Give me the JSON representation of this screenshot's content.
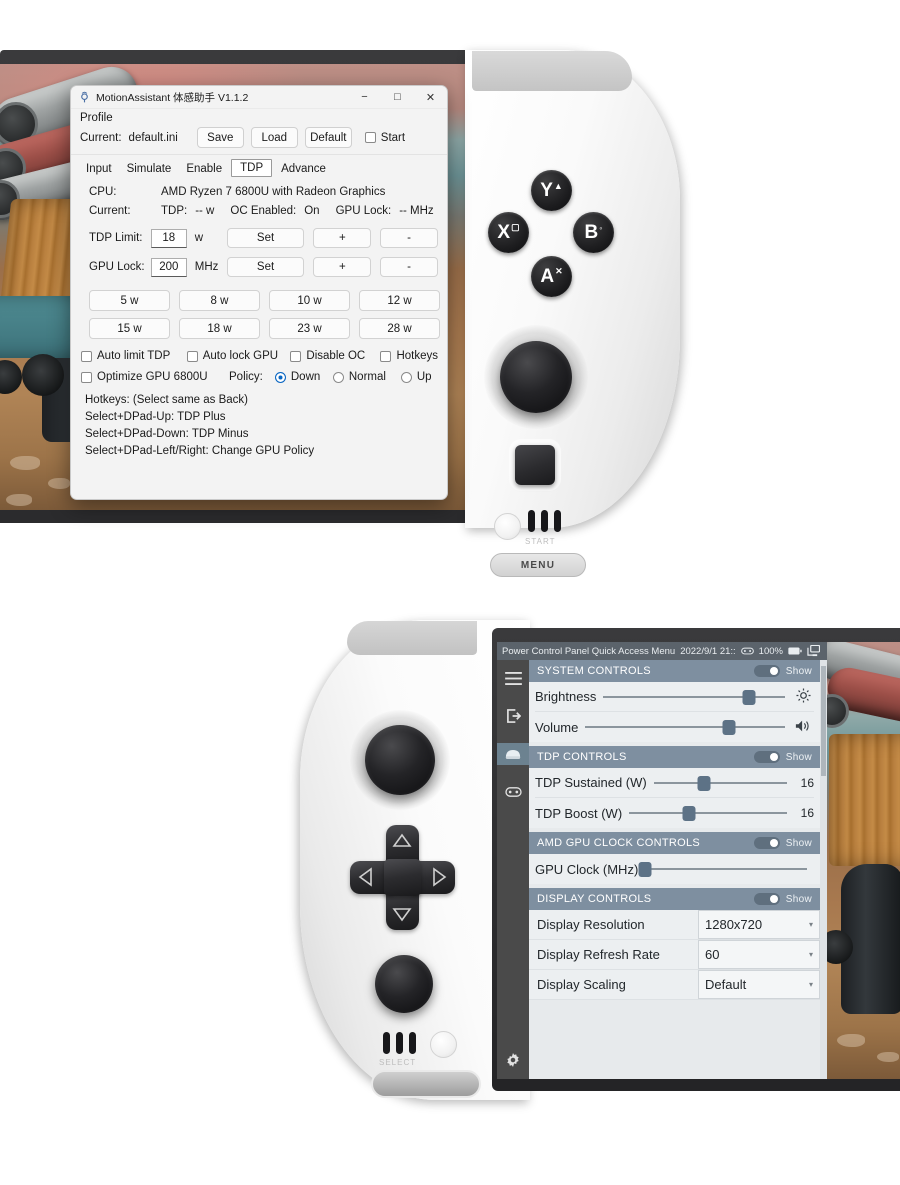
{
  "motion_assistant": {
    "title": "MotionAssistant 体感助手 V1.1.2",
    "icon": "app-icon",
    "window_controls": {
      "minimize": "−",
      "maximize": "□",
      "close": "✕"
    },
    "profile": {
      "heading": "Profile",
      "current_label": "Current:",
      "current_value": "default.ini",
      "save": "Save",
      "load": "Load",
      "default": "Default",
      "start_label": "Start",
      "start_checked": false
    },
    "tabs": [
      {
        "label": "Input",
        "active": false
      },
      {
        "label": "Simulate",
        "active": false
      },
      {
        "label": "Enable",
        "active": false
      },
      {
        "label": "TDP",
        "active": true
      },
      {
        "label": "Advance",
        "active": false
      }
    ],
    "cpu_label": "CPU:",
    "cpu_value": "AMD Ryzen 7 6800U with Radeon Graphics",
    "current_row": {
      "label": "Current:",
      "tdp_label": "TDP:",
      "tdp_value": "-- w",
      "oc_label": "OC Enabled:",
      "oc_value": "On",
      "gpu_lock_label": "GPU Lock:",
      "gpu_lock_value": "-- MHz"
    },
    "tdp_limit": {
      "label": "TDP Limit:",
      "value": "18",
      "unit": "w",
      "set": "Set",
      "plus": "+",
      "minus": "-"
    },
    "gpu_lock": {
      "label": "GPU Lock:",
      "value": "200",
      "unit": "MHz",
      "set": "Set",
      "plus": "+",
      "minus": "-"
    },
    "presets": [
      "5 w",
      "8 w",
      "10 w",
      "12 w",
      "15 w",
      "18 w",
      "23 w",
      "28 w"
    ],
    "checkboxes": [
      {
        "label": "Auto limit TDP",
        "checked": false
      },
      {
        "label": "Auto lock GPU",
        "checked": false
      },
      {
        "label": "Disable OC",
        "checked": false
      },
      {
        "label": "Hotkeys",
        "checked": false
      },
      {
        "label": "Optimize GPU 6800U",
        "checked": false
      }
    ],
    "policy": {
      "label": "Policy:",
      "options": [
        {
          "label": "Down",
          "selected": true
        },
        {
          "label": "Normal",
          "selected": false
        },
        {
          "label": "Up",
          "selected": false
        }
      ]
    },
    "hotkeys_text": [
      "Hotkeys:  (Select same as Back)",
      "Select+DPad-Up:  TDP Plus",
      "Select+DPad-Down:  TDP Minus",
      "Select+DPad-Left/Right: Change GPU Policy"
    ]
  },
  "power_control_panel": {
    "titlebar": {
      "title": "Power Control Panel Quick Access Menu",
      "datetime": "2022/9/1 21::",
      "gamepad_icon": "gamepad-icon",
      "battery_percent": "100%",
      "battery_icon": "battery-icon",
      "network_icon": "network-display-icon"
    },
    "sidebar": [
      {
        "icon": "hamburger-menu-icon",
        "active": false
      },
      {
        "icon": "exit-icon",
        "active": false
      },
      {
        "icon": "device-icon",
        "active": true
      },
      {
        "icon": "gamepad-icon",
        "active": false
      },
      {
        "icon": "gear-icon",
        "active": false
      }
    ],
    "groups": [
      {
        "title": "SYSTEM CONTROLS",
        "show_label": "Show",
        "show_on": true,
        "rows": [
          {
            "type": "slider",
            "name": "Brightness",
            "percent": 80,
            "icon": "brightness-icon"
          },
          {
            "type": "slider",
            "name": "Volume",
            "percent": 72,
            "icon": "volume-icon"
          }
        ]
      },
      {
        "title": "TDP CONTROLS",
        "show_label": "Show",
        "show_on": true,
        "rows": [
          {
            "type": "slider",
            "name": "TDP Sustained (W)",
            "percent": 38,
            "value": "16"
          },
          {
            "type": "slider",
            "name": "TDP Boost (W)",
            "percent": 38,
            "value": "16"
          }
        ]
      },
      {
        "title": "AMD GPU CLOCK CONTROLS",
        "show_label": "Show",
        "show_on": true,
        "rows": [
          {
            "type": "slider",
            "name": "GPU Clock (MHz)",
            "percent": 3,
            "value": ""
          }
        ]
      },
      {
        "title": "DISPLAY CONTROLS",
        "show_label": "Show",
        "show_on": true,
        "rows": [
          {
            "type": "select",
            "name": "Display Resolution",
            "value": "1280x720"
          },
          {
            "type": "select",
            "name": "Display Refresh Rate",
            "value": "60"
          },
          {
            "type": "select",
            "name": "Display Scaling",
            "value": "Default"
          }
        ]
      }
    ]
  },
  "handheld_top": {
    "face_buttons": [
      {
        "main": "Y",
        "sub": "▲"
      },
      {
        "main": "X",
        "sub": "▢"
      },
      {
        "main": "B",
        "sub": "◦"
      },
      {
        "main": "A",
        "sub": "✕"
      }
    ],
    "start_label": "START",
    "menu_label": "MENU",
    "stick": "analog-stick",
    "home_button": "home-square-button"
  },
  "handheld_bottom": {
    "select_label": "SELECT",
    "dpad": [
      "up",
      "down",
      "left",
      "right"
    ],
    "stick": "analog-stick",
    "round_button": "round-button"
  },
  "colors": {
    "accent_blue": "#0a66c2",
    "panel_header": "#7e8fa0",
    "panel_bg": "#eceff1",
    "titlebar": "#5b636b",
    "sidebar": "#4a4a4a",
    "sidebar_active": "#6c8290",
    "slider_knob": "#5d7286",
    "device_shell": "#2e2e30"
  }
}
